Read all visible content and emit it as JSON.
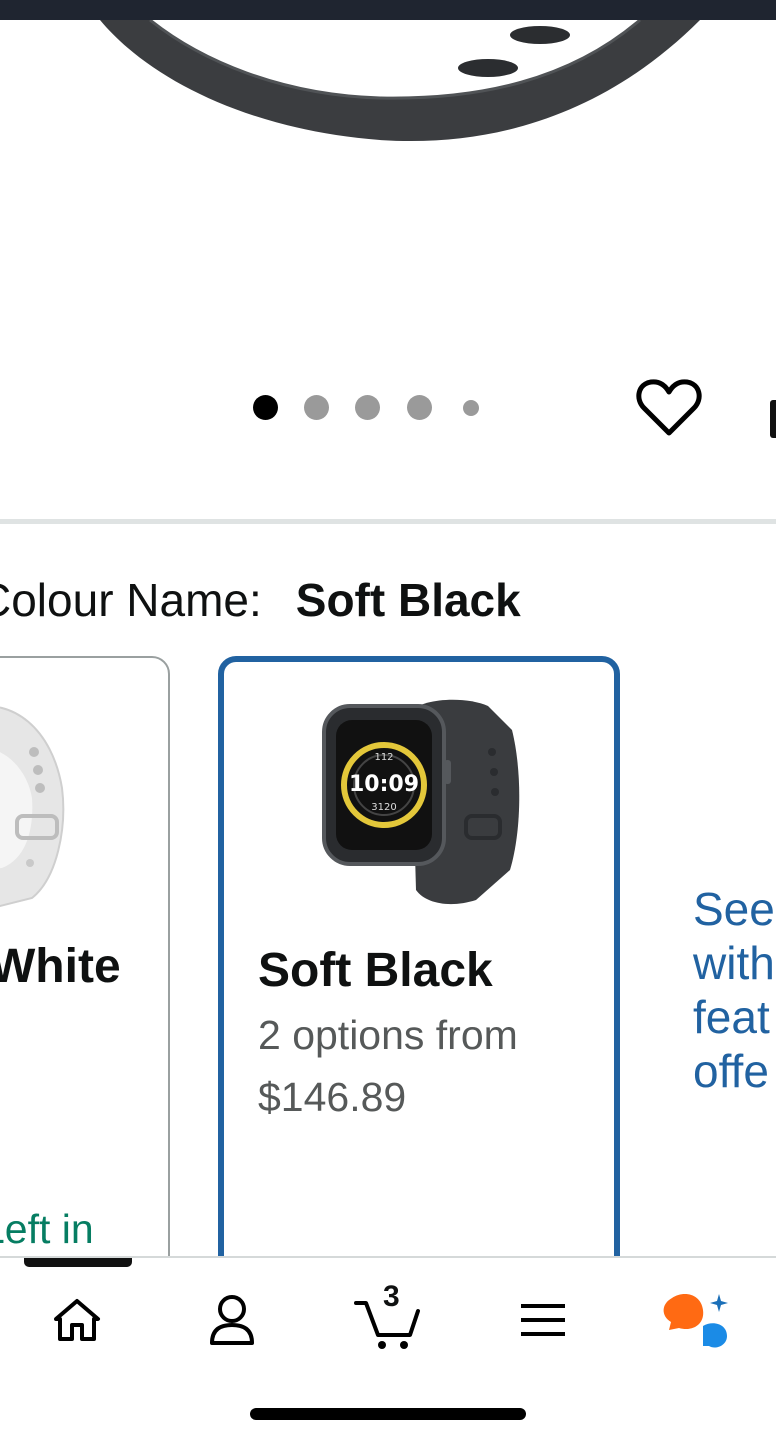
{
  "gallery": {
    "slide_count": 5,
    "active_slide": 1,
    "wishlist_icon": "heart-icon",
    "share_icon": "share-icon"
  },
  "variant": {
    "label": "Colour Name:",
    "selected": "Soft Black"
  },
  "swatches": [
    {
      "name": "White",
      "status": "Left in",
      "image": "white-smartwatch-image",
      "selected": false
    },
    {
      "name": "Soft Black",
      "subtitle_line1": "2 options from",
      "subtitle_line2": "$146.89",
      "image": "black-smartwatch-image",
      "selected": true
    }
  ],
  "watch_face": {
    "steps": "112",
    "time": "10:09",
    "cal": "3120"
  },
  "see_all": {
    "lines": [
      "See",
      "with",
      "feat",
      "offe"
    ]
  },
  "bottom_nav": {
    "items": [
      {
        "icon": "home-icon",
        "active": true
      },
      {
        "icon": "account-icon"
      },
      {
        "icon": "cart-icon",
        "badge": "3"
      },
      {
        "icon": "menu-icon"
      },
      {
        "icon": "rufus-ai-icon"
      }
    ]
  },
  "colors": {
    "accent_blue": "#2162a1",
    "in_stock_green": "#067d62",
    "rufus_orange": "#ff6a13",
    "rufus_blue": "#1b8be6"
  }
}
